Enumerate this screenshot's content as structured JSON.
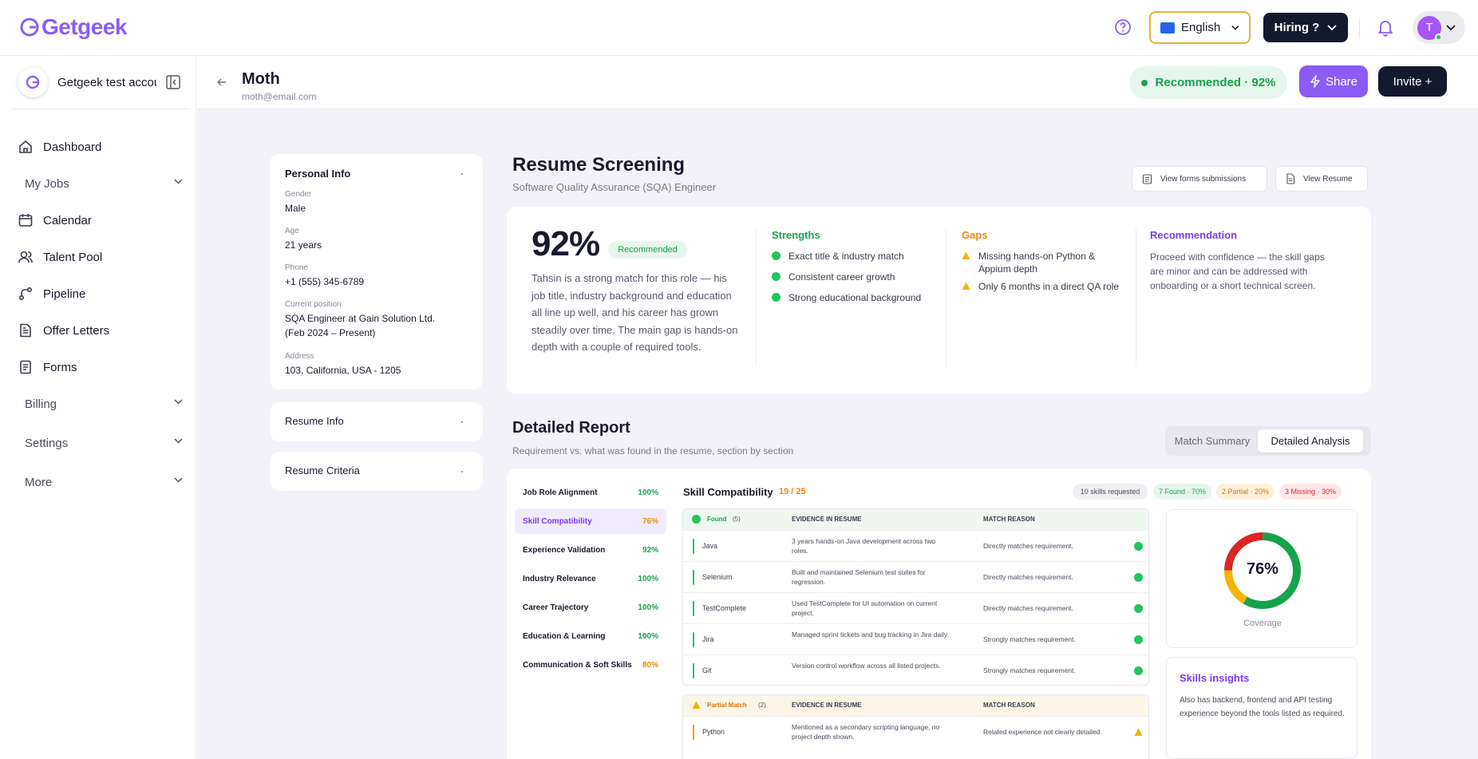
{
  "brand": {
    "name": "Getgeek",
    "accent": "#8b5cf6"
  },
  "topbar": {
    "language": "English",
    "hiring_label": "Hiring ?",
    "avatar_initial": "T"
  },
  "sidebar": {
    "account_name": "Getgeek test account",
    "items": [
      {
        "label": "Dashboard",
        "icon": "home-icon"
      },
      {
        "label": "My Jobs",
        "expandable": true
      },
      {
        "label": "Calendar",
        "icon": "calendar-icon"
      },
      {
        "label": "Talent Pool",
        "icon": "users-icon"
      },
      {
        "label": "Pipeline",
        "icon": "pipeline-icon"
      },
      {
        "label": "Offer Letters",
        "icon": "document-icon"
      },
      {
        "label": "Forms",
        "icon": "forms-icon"
      },
      {
        "label": "Billing",
        "expandable": true
      },
      {
        "label": "Settings",
        "expandable": true
      },
      {
        "label": "More",
        "expandable": true
      }
    ]
  },
  "candidate": {
    "name": "Moth",
    "email": "moth@email.com",
    "recommended_badge": "Recommended · 92%",
    "share_label": "Share",
    "invite_label": "Invite +"
  },
  "personal_info": {
    "title": "Personal Info",
    "fields": [
      {
        "label": "Gender",
        "value": "Male"
      },
      {
        "label": "Age",
        "value": "21 years"
      },
      {
        "label": "Phone",
        "value": "+1 (555) 345-6789"
      },
      {
        "label": "Current position",
        "value": "SQA Engineer at Gain Solution Ltd. (Feb 2024 – Present)"
      },
      {
        "label": "Address",
        "value": "103, California, USA - 1205"
      }
    ]
  },
  "panels": {
    "resume_info": "Resume Info",
    "resume_criteria": "Resume Criteria"
  },
  "screening": {
    "title": "Resume Screening",
    "subtitle": "Software Quality Assurance (SQA) Engineer",
    "view_forms": "View forms submissions",
    "view_resume": "View Resume",
    "score": "92%",
    "score_badge": "Recommended",
    "summary": "Tahsin is a strong match for this role — his job title, industry background and education all line up well, and his career has grown steadily over time. The main gap is hands-on depth with a couple of required tools.",
    "strengths_title": "Strengths",
    "strengths": [
      "Exact title & industry match",
      "Consistent career growth",
      "Strong educational background"
    ],
    "gaps_title": "Gaps",
    "gaps": [
      "Missing hands-on Python & Appium depth",
      "Only 6 months in a direct QA role"
    ],
    "recommendation_title": "Recommendation",
    "recommendation": "Proceed with confidence — the skill gaps are minor and can be addressed with onboarding or a short technical screen."
  },
  "report": {
    "title": "Detailed Report",
    "subtitle": "Requirement vs. what was found in the resume, section by section",
    "tabs": [
      "Match Summary",
      "Detailed Analysis"
    ],
    "active_tab": "Detailed Analysis",
    "criteria": [
      {
        "label": "Job Role Alignment",
        "pct": "100%",
        "level": "high"
      },
      {
        "label": "Skill Compatibility",
        "pct": "76%",
        "level": "mid",
        "active": true
      },
      {
        "label": "Experience Validation",
        "pct": "92%",
        "level": "high"
      },
      {
        "label": "Industry Relevance",
        "pct": "100%",
        "level": "high"
      },
      {
        "label": "Career Trajectory",
        "pct": "100%",
        "level": "high"
      },
      {
        "label": "Education & Learning",
        "pct": "100%",
        "level": "high"
      },
      {
        "label": "Communication & Soft Skills",
        "pct": "80%",
        "level": "mid"
      }
    ],
    "skill_title": "Skill Compatibility",
    "skill_score": "19 / 25",
    "chips": [
      "10 skills requested",
      "7 Found · 70%",
      "2 Partial · 20%",
      "3 Missing · 30%"
    ],
    "found": {
      "label": "Found",
      "count": "(5)",
      "col_evidence": "EVIDENCE IN RESUME",
      "col_reason": "MATCH REASON",
      "rows": [
        {
          "skill": "Java",
          "evidence": "3 years hands-on Java development across two roles.",
          "reason": "Directly matches requirement."
        },
        {
          "skill": "Selenium",
          "evidence": "Built and maintained Selenium test suites for regression.",
          "reason": "Directly matches requirement."
        },
        {
          "skill": "TestComplete",
          "evidence": "Used TestComplete for UI automation on current project.",
          "reason": "Directly matches requirement."
        },
        {
          "skill": "Jira",
          "evidence": "Managed sprint tickets and bug tracking in Jira daily.",
          "reason": "Strongly matches requirement."
        },
        {
          "skill": "Git",
          "evidence": "Version control workflow across all listed projects.",
          "reason": "Strongly matches requirement."
        }
      ]
    },
    "partial": {
      "label": "Partial Match",
      "count": "(2)",
      "col_evidence": "EVIDENCE IN RESUME",
      "col_reason": "MATCH REASON",
      "rows": [
        {
          "skill": "Python",
          "evidence": "Mentioned as a secondary scripting language, no project depth shown.",
          "reason": "Related experience not clearly detailed."
        }
      ]
    },
    "coverage": {
      "value": 76,
      "label_pct": "76%",
      "label": "Coverage",
      "segments": {
        "found": 70,
        "partial": 20,
        "missing": 30
      }
    },
    "insights": {
      "title": "Skills insights",
      "text": "Also has backend, frontend and API testing experience beyond the tools listed as required."
    }
  },
  "colors": {
    "green": "#22c55e",
    "orange": "#f59e0b",
    "red": "#dc2626",
    "purple": "#8b5cf6",
    "dark": "#141a2e"
  }
}
